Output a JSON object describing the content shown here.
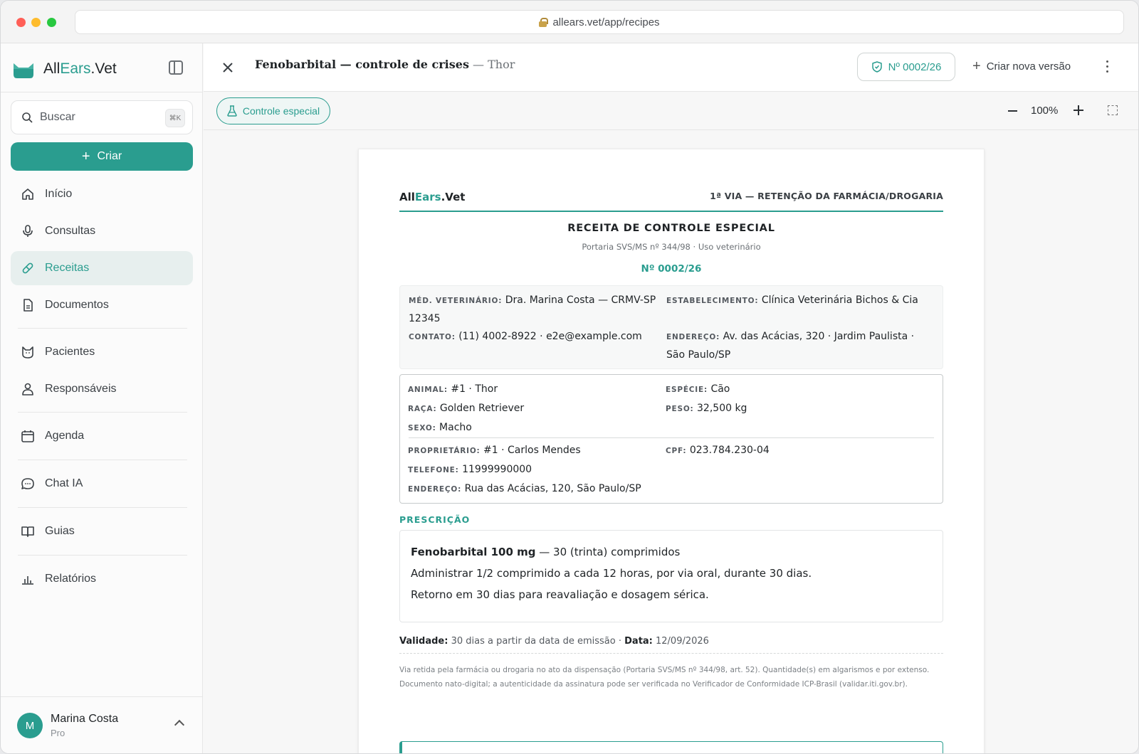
{
  "browser": {
    "url": "allears.vet/app/recipes"
  },
  "sidebar": {
    "brand_all": "All",
    "brand_ears": "Ears",
    "brand_vet": ".Vet",
    "search_placeholder": "Buscar",
    "search_shortcut": "⌘K",
    "create_label": "Criar",
    "items": [
      {
        "label": "Início",
        "icon": "home-icon"
      },
      {
        "label": "Consultas",
        "icon": "microphone-icon"
      },
      {
        "label": "Receitas",
        "icon": "pill-icon",
        "active": true
      },
      {
        "label": "Documentos",
        "icon": "document-icon"
      },
      {
        "label": "Pacientes",
        "icon": "cat-icon"
      },
      {
        "label": "Responsáveis",
        "icon": "person-icon"
      },
      {
        "label": "Agenda",
        "icon": "calendar-icon"
      },
      {
        "label": "Chat IA",
        "icon": "chat-icon"
      },
      {
        "label": "Guias",
        "icon": "book-icon"
      },
      {
        "label": "Relatórios",
        "icon": "bar-chart-icon"
      }
    ],
    "user": {
      "initial": "M",
      "name": "Marina Costa",
      "plan": "Pro"
    }
  },
  "header": {
    "title": "Fenobarbital — controle de crises",
    "subtitle": " — Thor",
    "number_badge": "Nº 0002/26",
    "new_version": "Criar nova versão"
  },
  "toolbar": {
    "chip": "Controle especial",
    "zoom": "100%"
  },
  "document": {
    "brand_all": "All",
    "brand_ears": "Ears",
    "brand_vet": ".Vet",
    "via": "1ª VIA — RETENÇÃO DA FARMÁCIA/DROGARIA",
    "heading": "RECEITA DE CONTROLE ESPECIAL",
    "portaria": "Portaria SVS/MS nº 344/98 · Uso veterinário",
    "number": "Nº 0002/26",
    "vet_key": "MÉD. VETERINÁRIO:",
    "vet_value": "Dra. Marina Costa — CRMV-SP 12345",
    "contact_key": "CONTATO:",
    "contact_value": "(11) 4002-8922 · e2e@example.com",
    "estab_key": "ESTABELECIMENTO:",
    "estab_value": "Clínica Veterinária Bichos & Cia",
    "address_key": "ENDEREÇO:",
    "address_value": "Av. das Acácias, 320 · Jardim Paulista · São Paulo/SP",
    "animal_key": "ANIMAL:",
    "animal_value": "#1 · Thor",
    "species_key": "ESPÉCIE:",
    "species_value": "Cão",
    "breed_key": "RAÇA:",
    "breed_value": "Golden Retriever",
    "weight_key": "PESO:",
    "weight_value": "32,500 kg",
    "sex_key": "SEXO:",
    "sex_value": "Macho",
    "owner_key": "PROPRIETÁRIO:",
    "owner_value": "#1 · Carlos Mendes",
    "cpf_key": "CPF:",
    "cpf_value": "023.784.230-04",
    "phone_key": "TELEFONE:",
    "phone_value": "11999990000",
    "owner_address_key": "ENDEREÇO:",
    "owner_address_value": "Rua das Acácias, 120, São Paulo/SP",
    "prescription_label": "PRESCRIÇÃO",
    "drug": "Fenobarbital 100 mg",
    "quantity": " — 30 (trinta) comprimidos",
    "instructions": "Administrar 1/2 comprimido a cada 12 horas, por via oral, durante 30 dias.",
    "followup": "Retorno em 30 dias para reavaliação e dosagem sérica.",
    "validity_key": "Validade:",
    "validity_value": " 30 dias a partir da data de emissão · ",
    "date_key": "Data:",
    "date_value": " 12/09/2026",
    "footnote": "Via retida pela farmácia ou drogaria no ato da dispensação (Portaria SVS/MS nº 344/98, art. 52). Quantidade(s) em algarismos e por extenso. Documento nato-digital; a autenticidade da assinatura pode ser verificada no Verificador de Conformidade ICP-Brasil (validar.iti.gov.br)."
  },
  "colors": {
    "accent": "#2a9d8f",
    "active_bg": "#e7efee"
  }
}
